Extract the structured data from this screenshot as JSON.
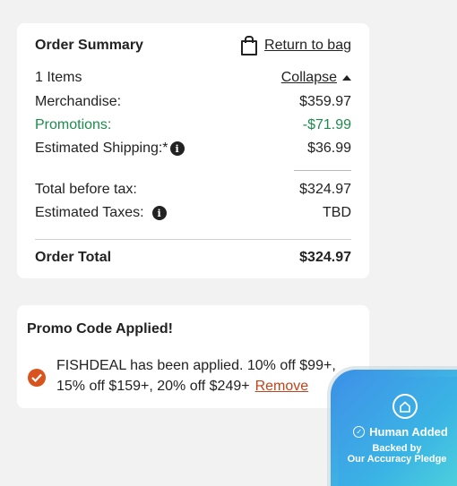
{
  "summary": {
    "title": "Order Summary",
    "return_link": "Return to bag",
    "items_count": "1 Items",
    "collapse_link": "Collapse",
    "merchandise_label": "Merchandise:",
    "merchandise_value": "$359.97",
    "promotions_label": "Promotions:",
    "promotions_value": "-$71.99",
    "shipping_label": "Estimated Shipping:*",
    "shipping_value": "$36.99",
    "before_tax_label": "Total before tax:",
    "before_tax_value": "$324.97",
    "taxes_label": "Estimated Taxes:",
    "taxes_value": "TBD",
    "order_total_label": "Order Total",
    "order_total_value": "$324.97"
  },
  "promo": {
    "title": "Promo Code Applied!",
    "message": "FISHDEAL has been applied. 10% off $99+, 15% off $159+, 20% off $249+",
    "remove_link": "Remove"
  },
  "badge": {
    "headline": "Human Added",
    "line1": "Backed by",
    "line2": "Our Accuracy Pledge"
  },
  "colors": {
    "promotion_green": "#1e8a4c",
    "remove_orange": "#c4421a",
    "check_orange": "#d9531e",
    "badge_blue": "#3ab4e4"
  },
  "icons": [
    "shopping-bag-icon",
    "caret-up-icon",
    "info-icon",
    "check-circle-icon",
    "house-icon",
    "check-icon"
  ]
}
